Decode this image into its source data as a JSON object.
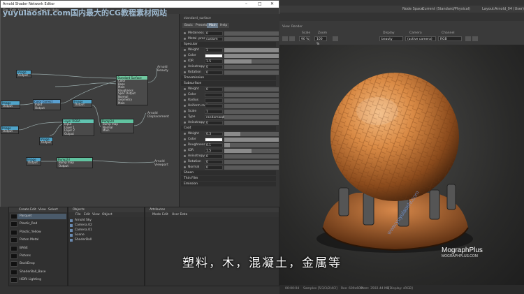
{
  "watermark_top": "yuyuIaoshi.com国内最大的CG教程素材网站",
  "subtitle": "塑料，木，混凝土，金属等",
  "brand": {
    "line1": "MographPlus",
    "line2": "MOGRAPHPLUS.COM",
    "diagonal": "www.yuyulaoshi.com"
  },
  "app_topbar": {
    "node_space_label": "Node Space:",
    "node_space_value": "Current (Standard/Physical)",
    "layout_label": "Layout:",
    "layout_value": "Arnold_04 (User)"
  },
  "render_toolbar": {
    "view_label": "View",
    "render_label": "Render",
    "scale_label": "Scale",
    "scale_value": "90 %",
    "zoom_label": "Zoom",
    "zoom_value": "100 %",
    "display_label": "Display",
    "display_value": "beauty",
    "camera_label": "Camera",
    "camera_value": "(active camera)",
    "channel_label": "Channel",
    "channel_value": "RGB"
  },
  "statusbar": {
    "time": "00:00:04",
    "samples": "Samples [5/3/3/2/4/2]",
    "res": "Res: 609x609",
    "mem": "Mem: 3592.44 MB",
    "color": "[Display: sRGB]"
  },
  "shader_window": {
    "title": "Arnold Shader Network Editor",
    "menu": [
      "File",
      "Edit",
      "View",
      "Preset",
      "Texture",
      "Help"
    ],
    "node_header": "standard_surface",
    "tabs": [
      "Basic",
      "Presets",
      "Main",
      "Help"
    ],
    "active_tab": "Main"
  },
  "graph": {
    "outputs": [
      "Arnold Beauty",
      "Arnold Displacement",
      "Arnold Viewport"
    ],
    "nodes": [
      {
        "title": "Image",
        "ports": [
          "Output"
        ]
      },
      {
        "title": "Image",
        "ports": [
          "Output"
        ]
      },
      {
        "title": "Color Correct",
        "ports": [
          "Input",
          "Output"
        ]
      },
      {
        "title": "Image",
        "ports": [
          "Output"
        ]
      },
      {
        "title": "Layer RGBA",
        "ports": [
          "Input",
          "Layer 1",
          "Layer 2",
          "Output"
        ]
      },
      {
        "title": "Image",
        "ports": [
          "Output"
        ]
      },
      {
        "title": "Standard Surface",
        "ports": [
          "Color",
          "Base",
          "Main",
          "Roughness",
          "Spec Output",
          "Normal",
          "Geometry",
          "Main"
        ]
      },
      {
        "title": "Bump2d",
        "ports": [
          "Bump map",
          "Normal",
          "Main"
        ]
      },
      {
        "title": "Image",
        "ports": [
          "Output"
        ]
      },
      {
        "title": "Image",
        "ports": [
          "Output"
        ]
      },
      {
        "title": "Bump2d",
        "ports": [
          "Bump map",
          "Output"
        ]
      }
    ]
  },
  "attributes": {
    "top_rows": [
      {
        "label": "Metalness",
        "value": "0",
        "fill": 0.0
      },
      {
        "label": "Metal .preset",
        "value": "custom",
        "fill": 0.0
      }
    ],
    "specular": {
      "title": "Specular",
      "rows": [
        {
          "label": "Weight",
          "value": "1",
          "fill": 1.0
        },
        {
          "label": "Color",
          "value": "",
          "fill": 1.0,
          "swatch": "#ffffff"
        },
        {
          "label": "IOR",
          "value": "1.5",
          "fill": 0.5
        },
        {
          "label": "Anisotropy",
          "value": "0",
          "fill": 0.0
        },
        {
          "label": "Rotation",
          "value": "0",
          "fill": 0.0
        }
      ]
    },
    "transmission": "Transmission",
    "subsurface": {
      "title": "Subsurface",
      "rows": [
        {
          "label": "Weight",
          "value": "0",
          "fill": 0.0
        },
        {
          "label": "Color",
          "value": "",
          "fill": 0.0
        },
        {
          "label": "Radius",
          "value": "",
          "fill": 0.0
        },
        {
          "label": "Uniform radius",
          "value": "",
          "fill": 0.0
        },
        {
          "label": "Scale",
          "value": "1",
          "fill": 0.0
        },
        {
          "label": "Type",
          "value": "randomwalk",
          "fill": 0.0
        },
        {
          "label": "Anisotropy",
          "value": "0",
          "fill": 0.0
        }
      ]
    },
    "coat": {
      "title": "Coat",
      "rows": [
        {
          "label": "Weight",
          "value": "0.3",
          "fill": 0.3
        },
        {
          "label": "Color",
          "value": "",
          "fill": 1.0,
          "swatch": "#ffffff"
        },
        {
          "label": "Roughness",
          "value": "0.1",
          "fill": 0.1
        },
        {
          "label": "IOR",
          "value": "1.5",
          "fill": 0.5
        },
        {
          "label": "Anisotropy",
          "value": "0",
          "fill": 0.0
        },
        {
          "label": "Rotation",
          "value": "0",
          "fill": 0.0
        },
        {
          "label": "Normal",
          "value": "0",
          "fill": 0.0
        }
      ]
    },
    "sheen": "Sheen",
    "thin_film": "Thin Film",
    "emission": "Emission"
  },
  "materials_panel": {
    "menu": [
      "Create",
      "Edit",
      "View",
      "Select"
    ],
    "items": [
      "Parquet",
      "Plastic_Red",
      "Plastic_Yellow",
      "Piston Metal",
      "BASE",
      "Pistons",
      "BackDrop",
      "ShaderBall_Base",
      "HDRI Lighting"
    ],
    "selected": "Parquet"
  },
  "objects_panel": {
    "title": "Objects",
    "menu": [
      "File",
      "Edit",
      "View",
      "Object"
    ],
    "items": [
      "Arnold Sky",
      "Camera.02",
      "Camera.01",
      "Scene",
      "ShaderBall"
    ]
  },
  "attributes_panel": {
    "title": "Attributes",
    "menu": [
      "Mode",
      "Edit",
      "User Data"
    ]
  }
}
